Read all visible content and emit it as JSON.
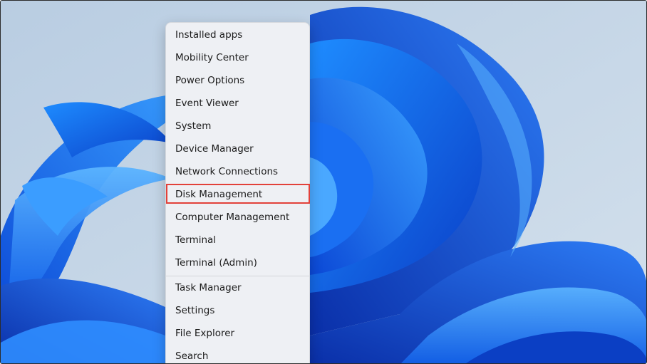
{
  "menu": {
    "items": [
      {
        "label": "Installed apps"
      },
      {
        "label": "Mobility Center"
      },
      {
        "label": "Power Options"
      },
      {
        "label": "Event Viewer"
      },
      {
        "label": "System"
      },
      {
        "label": "Device Manager"
      },
      {
        "label": "Network Connections"
      },
      {
        "label": "Disk Management",
        "highlighted": true
      },
      {
        "label": "Computer Management"
      },
      {
        "label": "Terminal"
      },
      {
        "label": "Terminal (Admin)"
      },
      {
        "label": "Task Manager"
      },
      {
        "label": "Settings"
      },
      {
        "label": "File Explorer"
      },
      {
        "label": "Search"
      }
    ]
  },
  "colors": {
    "menu_background": "#eef0f4",
    "highlight_border": "#e2413a",
    "wallpaper_sky": "#c4d6e8",
    "wallpaper_bloom": "#0a5be6"
  }
}
